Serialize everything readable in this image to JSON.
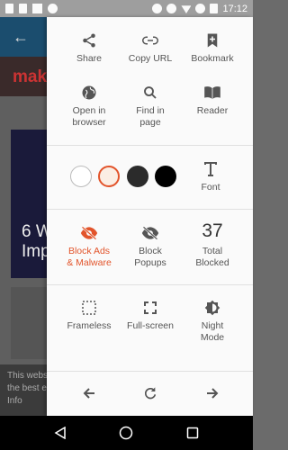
{
  "status_bar": {
    "time": "17:12"
  },
  "background_page": {
    "brand_fragment": "mak",
    "headline_fragment": "6 W\nImp",
    "cookie_fragment": "This webs\nthe best e\nInfo"
  },
  "menu": {
    "row1": [
      {
        "label": "Share",
        "icon": "share-icon"
      },
      {
        "label": "Copy URL",
        "icon": "link-icon"
      },
      {
        "label": "Bookmark",
        "icon": "bookmark-icon"
      }
    ],
    "row2": [
      {
        "label": "Open in\nbrowser",
        "icon": "globe-icon"
      },
      {
        "label": "Find in\npage",
        "icon": "search-icon"
      },
      {
        "label": "Reader",
        "icon": "book-icon"
      }
    ],
    "font_label": "Font",
    "themes": [
      "white",
      "sepia",
      "dark-gray",
      "black"
    ],
    "theme_colors": {
      "white": "#ffffff",
      "sepia": "#fbeee4",
      "dark_gray": "#2b2b2b",
      "black": "#000000",
      "selected_ring": "#e2542b"
    },
    "blocking": {
      "block_ads": "Block Ads\n& Malware",
      "block_popups": "Block\nPopups",
      "total_blocked_count": "37",
      "total_blocked_label": "Total\nBlocked"
    },
    "modes": [
      {
        "label": "Frameless",
        "icon": "frameless-icon"
      },
      {
        "label": "Full-screen",
        "icon": "fullscreen-icon"
      },
      {
        "label": "Night\nMode",
        "icon": "night-mode-icon"
      }
    ],
    "accent_color": "#e2542b"
  }
}
